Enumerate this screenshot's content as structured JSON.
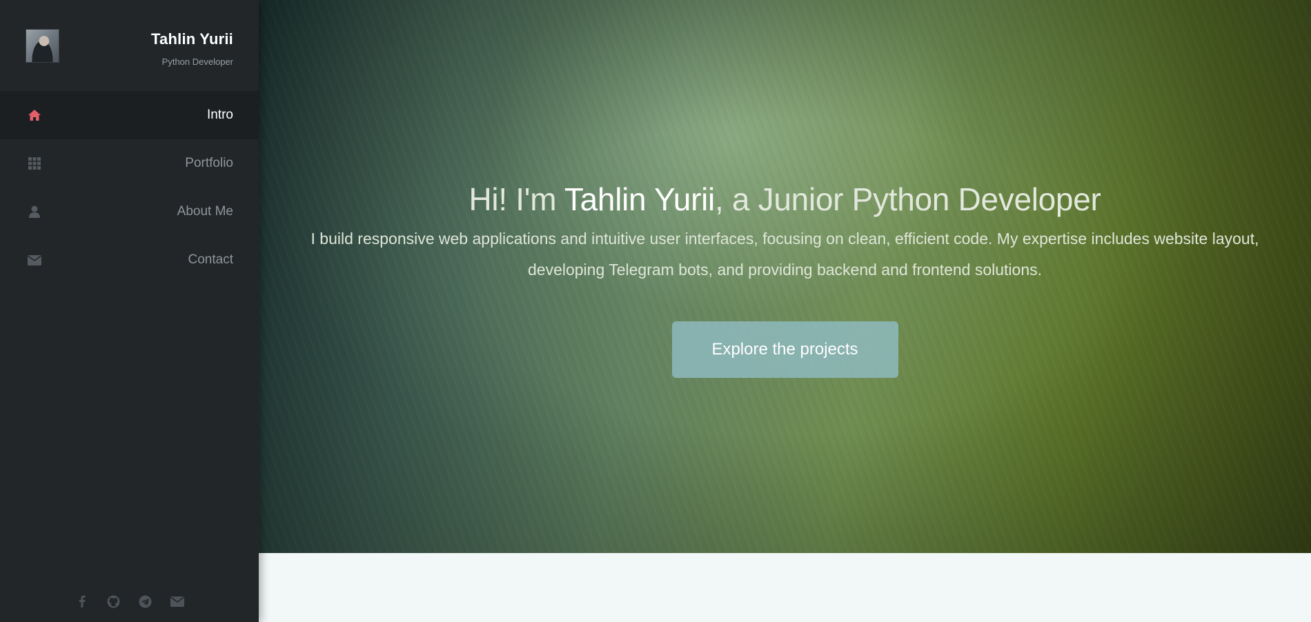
{
  "sidebar": {
    "name": "Tahlin Yurii",
    "role": "Python Developer",
    "nav": [
      {
        "label": "Intro",
        "icon": "home-icon",
        "active": true
      },
      {
        "label": "Portfolio",
        "icon": "grid-icon",
        "active": false
      },
      {
        "label": "About Me",
        "icon": "user-icon",
        "active": false
      },
      {
        "label": "Contact",
        "icon": "envelope-icon",
        "active": false
      }
    ],
    "social": [
      "facebook-icon",
      "github-icon",
      "telegram-icon",
      "email-icon"
    ]
  },
  "hero": {
    "title_prefix": "Hi! I'm ",
    "title_name": "Tahlin Yurii",
    "title_suffix": ", a Junior Python Developer",
    "description": "I build responsive web applications and intuitive user interfaces, focusing on clean, efficient code. My expertise includes website layout, developing Telegram bots, and providing backend and frontend solutions.",
    "button_label": "Explore the projects"
  },
  "colors": {
    "sidebar_bg": "#222629",
    "active_item_bg": "#1b1f22",
    "accent_icon": "#e35d6a",
    "muted_icon": "#555b60",
    "button_bg": "#8ebabe"
  }
}
